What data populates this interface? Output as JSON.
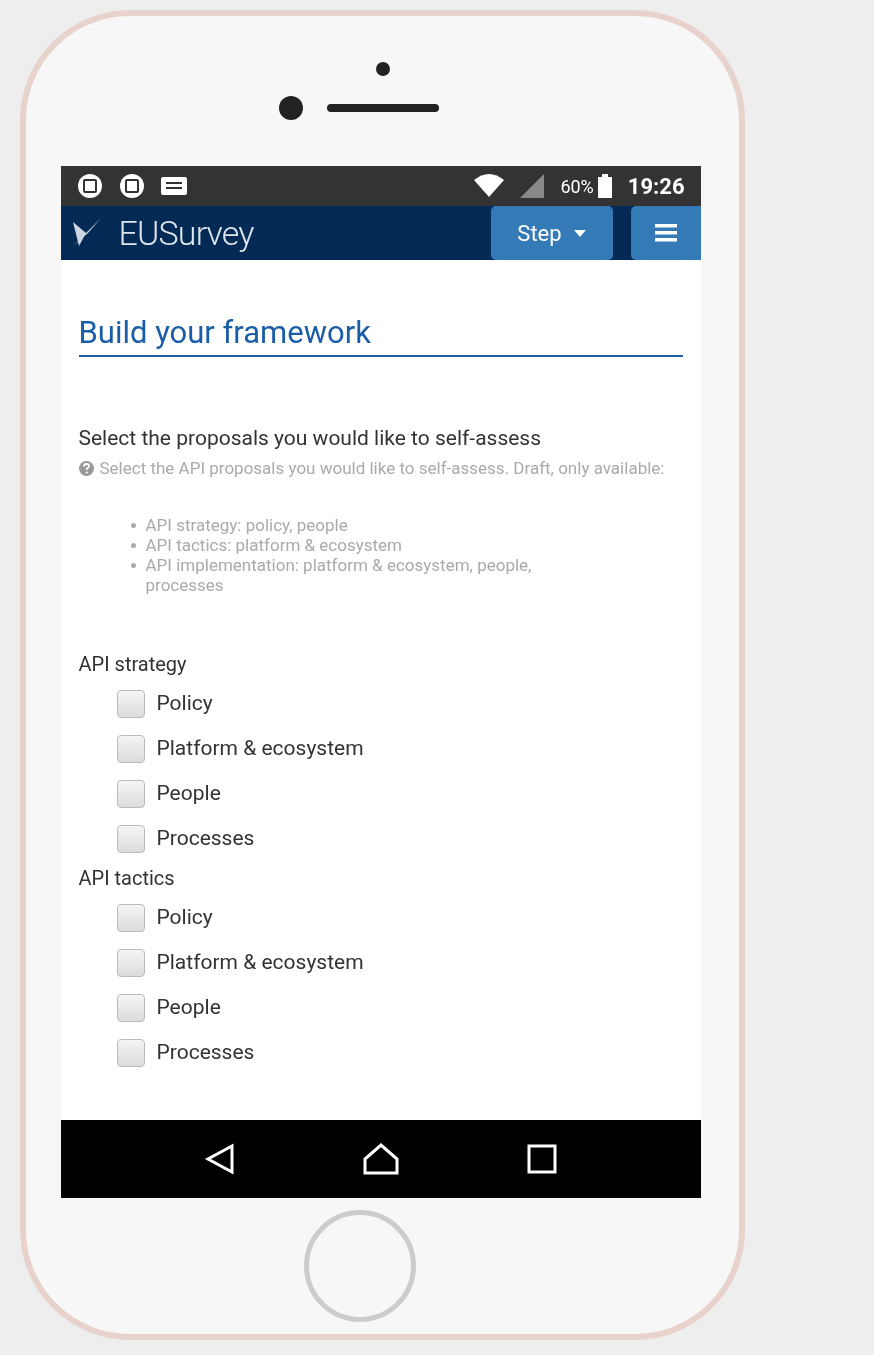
{
  "status_bar": {
    "battery": "60%",
    "time": "19:26"
  },
  "navbar": {
    "logo": "EUSurvey",
    "step_button": "Step"
  },
  "content": {
    "title": "Build your framework",
    "question": "Select the proposals you would like to self-assess",
    "help": "Select the API proposals you would like to self-assess. Draft, only available:",
    "help_items": [
      "API strategy: policy, people",
      "API tactics: platform & ecosystem",
      "API implementation: platform & ecosystem, people, processes"
    ],
    "groups": [
      {
        "label": "API strategy",
        "options": [
          {
            "label": "Policy",
            "checked": false
          },
          {
            "label": "Platform & ecosystem",
            "checked": false
          },
          {
            "label": "People",
            "checked": false
          },
          {
            "label": "Processes",
            "checked": false
          }
        ]
      },
      {
        "label": "API tactics",
        "options": [
          {
            "label": "Policy",
            "checked": false
          },
          {
            "label": "Platform & ecosystem",
            "checked": false
          },
          {
            "label": "People",
            "checked": false
          },
          {
            "label": "Processes",
            "checked": false
          }
        ]
      }
    ]
  }
}
